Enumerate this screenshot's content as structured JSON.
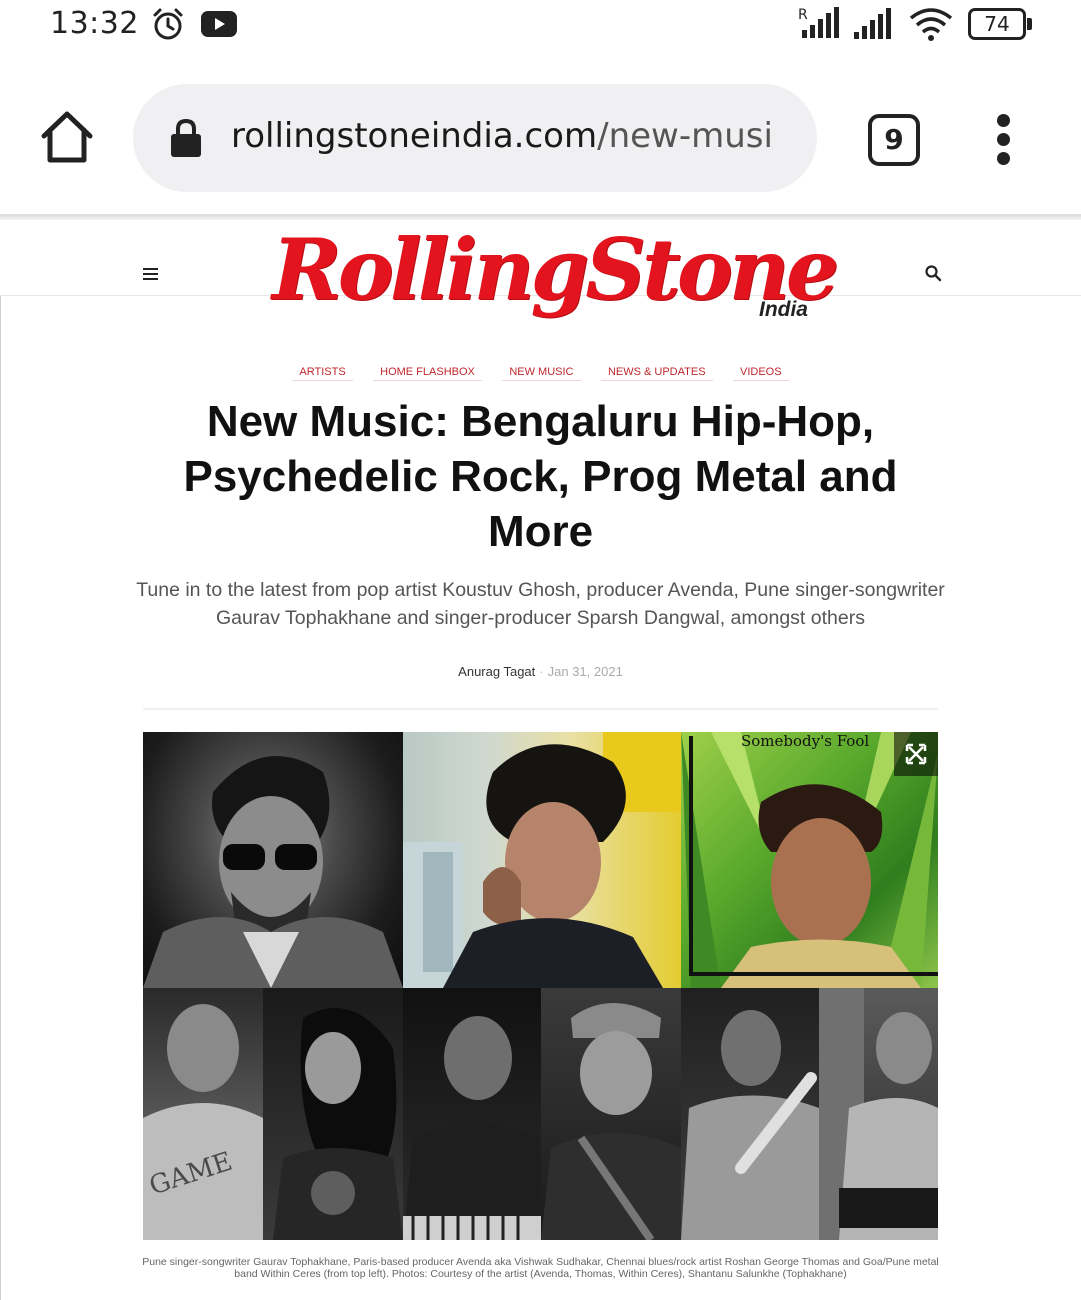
{
  "status_bar": {
    "time": "13:32",
    "icons": [
      "alarm-clock-icon",
      "youtube-icon",
      "signal-roaming-icon",
      "signal-icon",
      "wifi-icon"
    ],
    "battery_level": "74"
  },
  "browser": {
    "url_domain": "rollingstoneindia.com",
    "url_path": "/new-musi",
    "tab_count": "9"
  },
  "site": {
    "logo_text": "RollingStone",
    "logo_sub": "India"
  },
  "article": {
    "categories": [
      "ARTISTS",
      "HOME FLASHBOX",
      "NEW MUSIC",
      "NEWS & UPDATES",
      "VIDEOS"
    ],
    "title": "New Music: Bengaluru Hip-Hop, Psychedelic Rock, Prog Metal and More",
    "subtitle": "Tune in to the latest from pop artist Koustuv Ghosh, producer Avenda, Pune singer-songwriter Gaurav Tophakhane and singer-producer Sparsh Dangwal, amongst others",
    "author": "Anurag Tagat",
    "date": "Jan 31, 2021",
    "image_overlay_text": "Somebody's Fool",
    "caption": "Pune singer-songwriter Gaurav Tophakhane, Paris-based producer Avenda aka Vishwak Sudhakar, Chennai blues/rock artist Roshan George Thomas and Goa/Pune metal band Within Ceres (from top left). Photos: Courtesy of the artist (Avenda, Thomas, Within Ceres), Shantanu Salunkhe (Tophakhane)"
  },
  "colors": {
    "brand_red": "#e3141d",
    "category_red": "#c0272d"
  }
}
